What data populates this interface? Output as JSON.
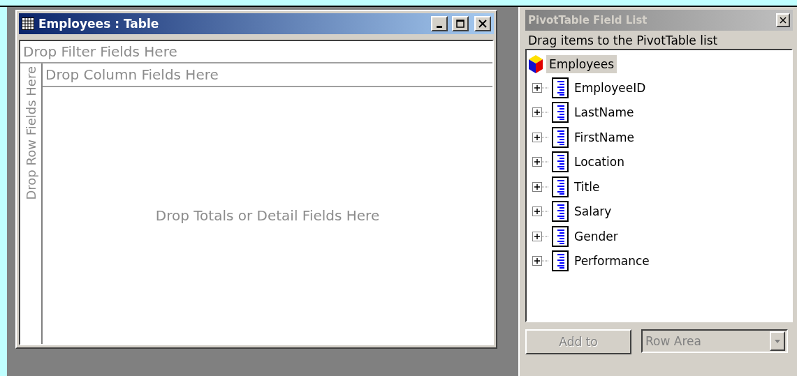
{
  "table_window": {
    "title": "Employees : Table",
    "filter_zone": "Drop Filter Fields Here",
    "column_zone": "Drop Column Fields Here",
    "row_zone": "Drop Row Fields Here",
    "data_zone": "Drop Totals or Detail Fields Here"
  },
  "field_list": {
    "title": "PivotTable Field List",
    "hint": "Drag items to the PivotTable list",
    "root": {
      "label": "Employees",
      "selected": true,
      "children": [
        {
          "label": "EmployeeID",
          "selected": false,
          "expanded": false
        },
        {
          "label": "LastName",
          "selected": false,
          "expanded": false
        },
        {
          "label": "FirstName",
          "selected": false,
          "expanded": false
        },
        {
          "label": "Location",
          "selected": false,
          "expanded": false
        },
        {
          "label": "Title",
          "selected": false,
          "expanded": false
        },
        {
          "label": "Salary",
          "selected": false,
          "expanded": false
        },
        {
          "label": "Gender",
          "selected": false,
          "expanded": false
        },
        {
          "label": "Performance",
          "selected": false,
          "expanded": false
        }
      ]
    },
    "add_button": {
      "label": "Add to",
      "disabled": true
    },
    "area_select": {
      "value": "Row Area",
      "disabled": true
    }
  }
}
